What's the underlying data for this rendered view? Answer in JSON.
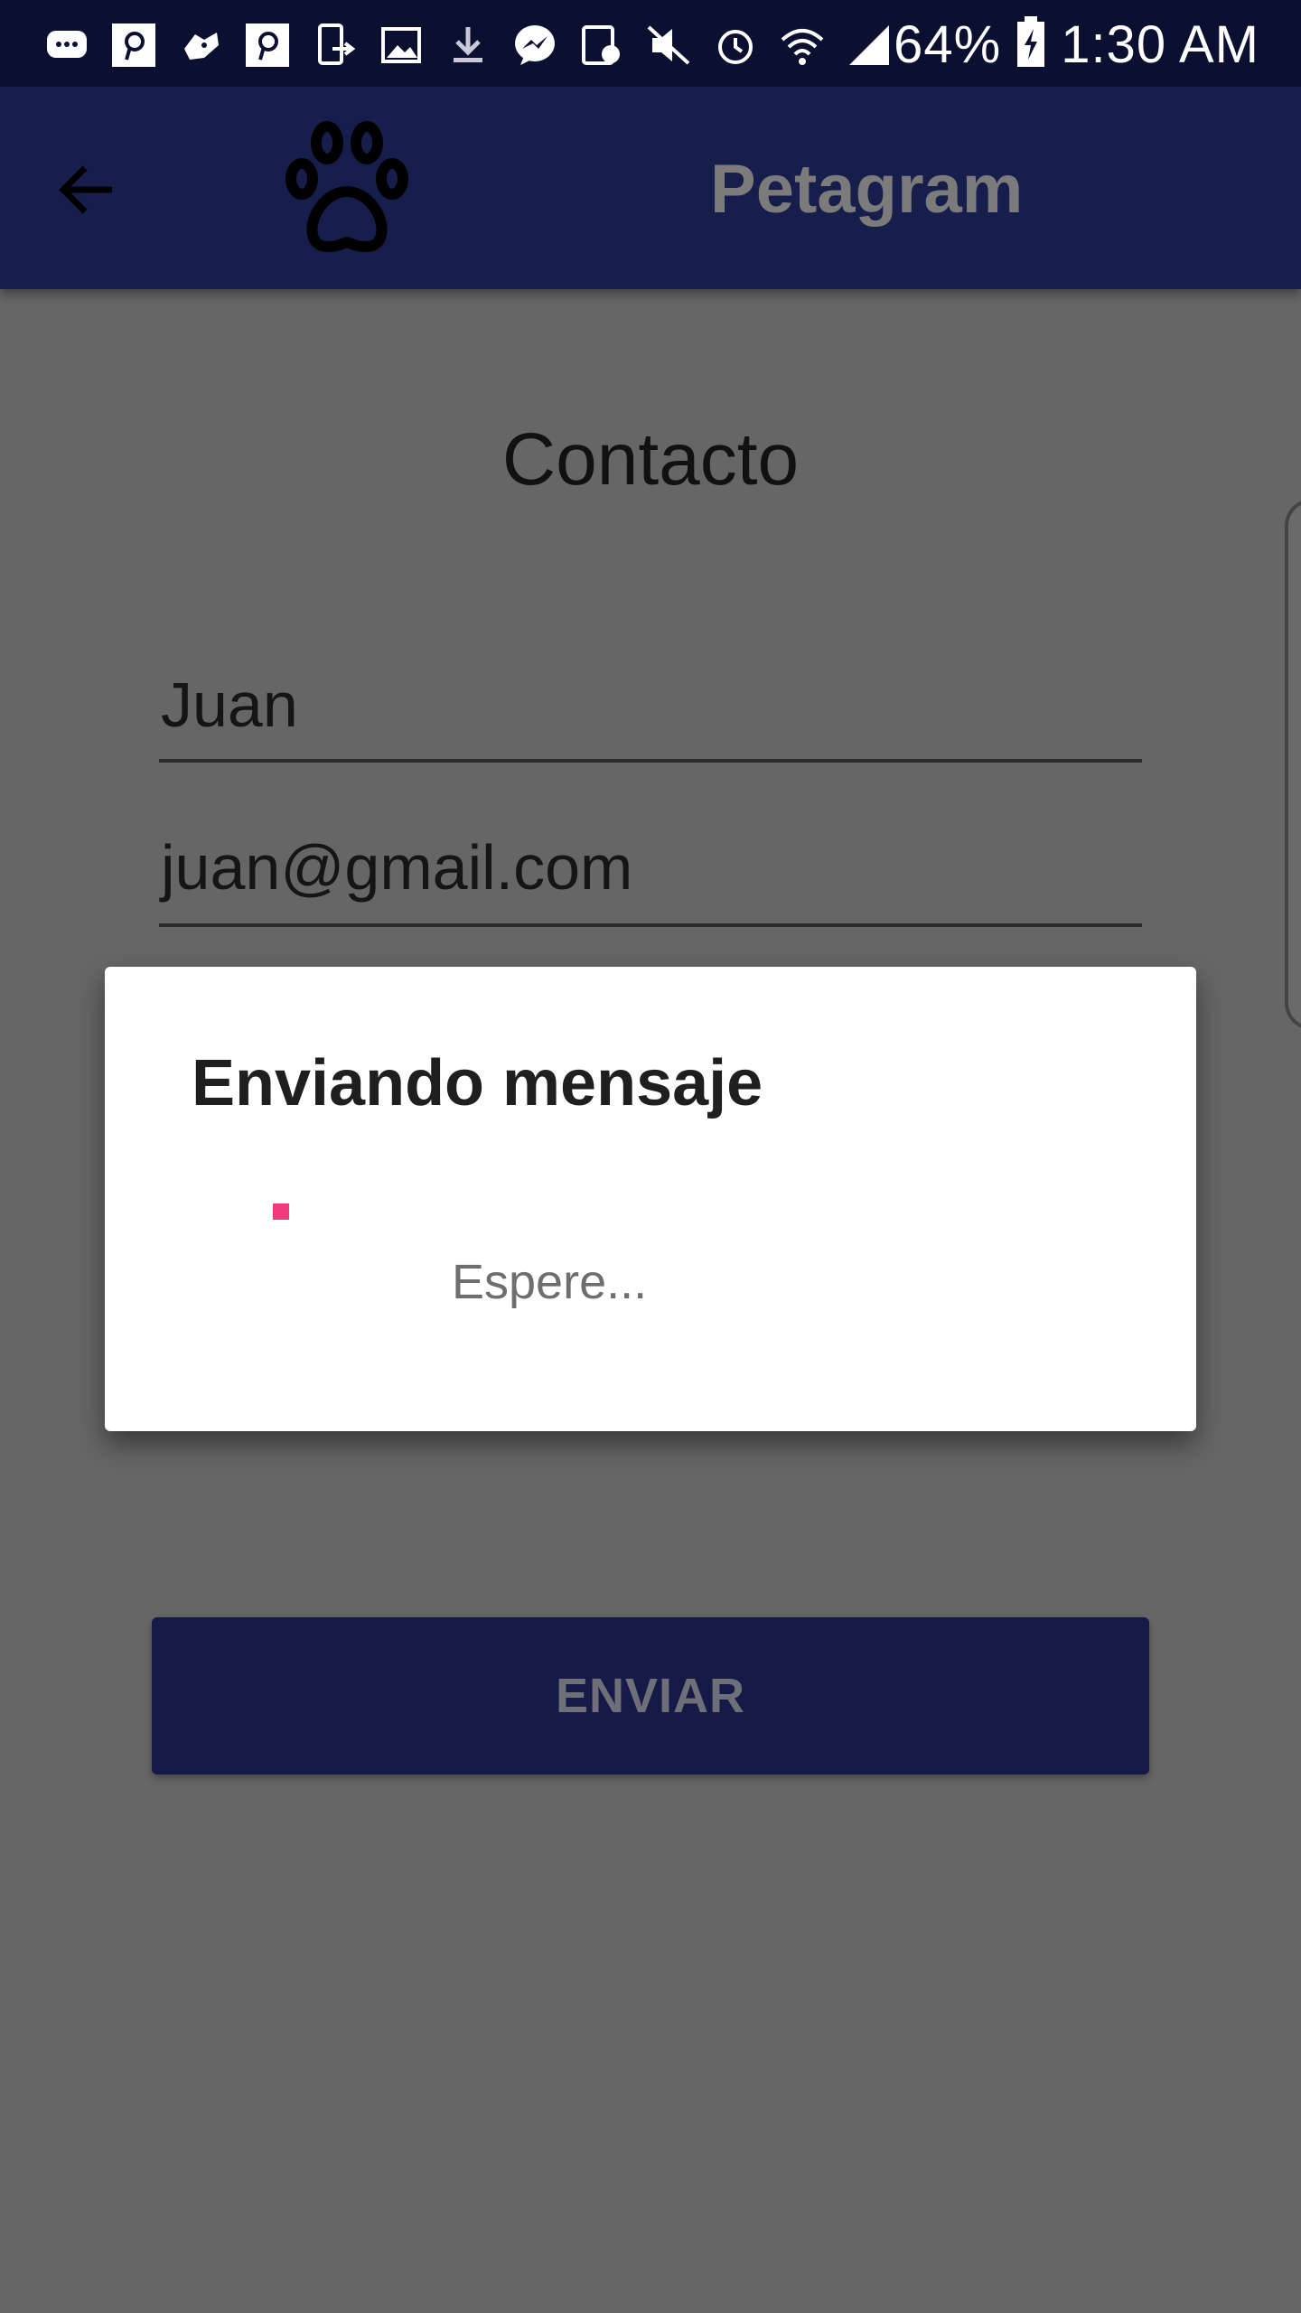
{
  "status_bar": {
    "battery": "64%",
    "time": "1:30 AM",
    "icons": [
      "messages-icon",
      "pinterest-icon",
      "game-controller-icon",
      "pinterest-icon",
      "phone-transfer-icon",
      "gallery-icon",
      "download-icon",
      "messenger-icon",
      "calendar-icon",
      "mute-icon",
      "alarm-icon",
      "wifi-icon",
      "signal-icon",
      "battery-charging-icon"
    ]
  },
  "app_bar": {
    "title": "Petagram",
    "back_icon": "arrow-back-icon",
    "logo_icon": "paw-icon"
  },
  "form": {
    "heading": "Contacto",
    "name_value": "Juan",
    "email_value": "juan@gmail.com",
    "submit_label": "ENVIAR"
  },
  "dialog": {
    "title": "Enviando mensaje",
    "message": "Espere...",
    "spinner_color": "#ef3b7c"
  },
  "colors": {
    "primary": "#181e4c",
    "status_bar": "#0c1030",
    "accent": "#ef3b7c"
  }
}
